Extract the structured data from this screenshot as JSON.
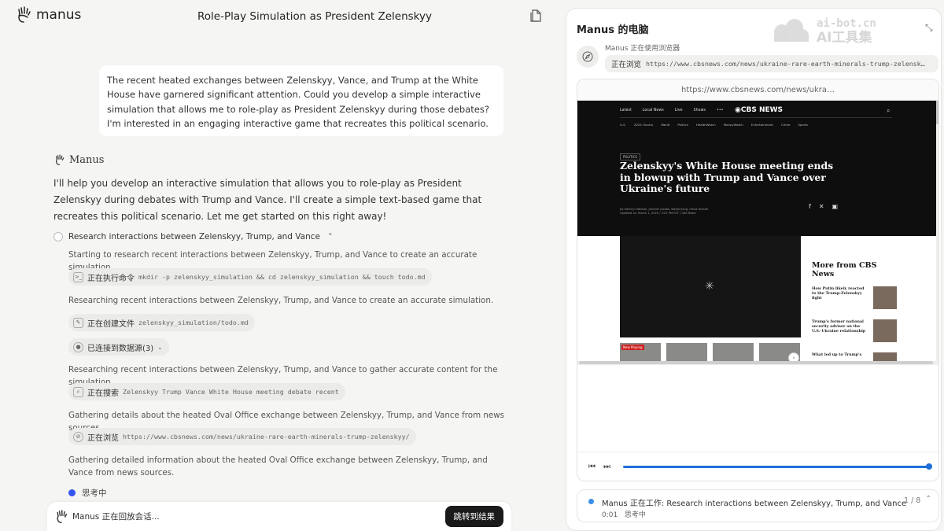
{
  "app": {
    "logo_text": "manus",
    "title": "Role-Play Simulation as President Zelenskyy"
  },
  "user_message": "The recent heated exchanges between Zelenskyy, Vance, and Trump at the White House have garnered significant attention. Could you develop a simple interactive simulation that allows me to role-play as President Zelenskyy during those debates? I'm interested in an engaging interactive game that recreates this political scenario.",
  "assistant": {
    "name": "Manus",
    "intro": "I'll help you develop an interactive simulation that allows you to role-play as President Zelenskyy during debates with Trump and Vance. I'll create a simple text-based game that recreates this political scenario. Let me get started on this right away!",
    "task_title": "Research interactions between Zelenskyy, Trump, and Vance",
    "steps": [
      "Starting to research recent interactions between Zelenskyy, Trump, and Vance to create an accurate simulation.",
      "Researching recent interactions between Zelenskyy, Trump, and Vance to create an accurate simulation.",
      "Researching recent interactions between Zelenskyy, Trump, and Vance to gather accurate content for the simulation.",
      "Gathering details about the heated Oval Office exchange between Zelenskyy, Trump, and Vance from news sources.",
      "Gathering detailed information about the heated Oval Office exchange between Zelenskyy, Trump, and Vance from news sources."
    ],
    "pills": [
      {
        "label": "正在执行命令",
        "detail": "mkdir -p zelenskyy_simulation && cd zelenskyy_simulation && touch todo.md"
      },
      {
        "label": "正在创建文件",
        "detail": "zelenskyy_simulation/todo.md"
      },
      {
        "label": "已连接到数据源(3)",
        "detail": ""
      },
      {
        "label": "正在搜索",
        "detail": "Zelenskyy Trump Vance White House meeting debate recent"
      },
      {
        "label": "正在浏览",
        "detail": "https://www.cbsnews.com/news/ukraine-rare-earth-minerals-trump-zelenskyy/"
      }
    ],
    "thinking": "思考中"
  },
  "bottom": {
    "message": "Manus 正在回放会话...",
    "jump_label": "跳转到结果"
  },
  "panel": {
    "title": "Manus 的电脑",
    "watermark_line1": "ai-bot.cn",
    "watermark_line2": "AI工具集",
    "uses_browser": "Manus 正在使用浏览器",
    "browsing_label": "正在浏览",
    "browsing_url": "https://www.cbsnews.com/news/ukraine-rare-earth-minerals-trump-zelensk…",
    "url_bar": "https://www.cbsnews.com/news/ukra…",
    "site": {
      "nav_primary": [
        "Latest",
        "Local News",
        "Live",
        "Shows",
        "•••"
      ],
      "brand": "CBS NEWS",
      "nav_secondary": [
        "U.S.",
        "2025 Oscars",
        "World",
        "Politics",
        "HealthWatch",
        "MoneyWatch",
        "Entertainment",
        "Crime",
        "Sports"
      ],
      "section_badge": "POLITICS",
      "headline": "Zelenskyy's White House meeting ends in blowup with Trump and Vance over Ukraine's future",
      "byline": "By Kathryn Watson, Jennifer Jacobs, Weijia Jiang, Olivia Rinaldi",
      "updated": "Updated on: March 1, 2025 / 3:01 PM EST / CBS News",
      "now_playing": "New Playing",
      "more_title": "More from CBS News",
      "stories": [
        "How Putin likely reacted to the Trump-Zelenskyy fight",
        "Trump's former national security adviser on the U.S.-Ukraine relationship",
        "What led up to Trump's"
      ]
    },
    "playback_progress": 1.0,
    "status_text": "Manus 正在工作: Research interactions between Zelenskyy, Trump, and Vance",
    "status_time": "0:01",
    "status_sub": "思考中",
    "step_counter": "1 / 8"
  },
  "colors": {
    "accent": "#1e6fd9",
    "thinking_dot": "#3355ee",
    "jump_bg": "#1a1a1a"
  }
}
